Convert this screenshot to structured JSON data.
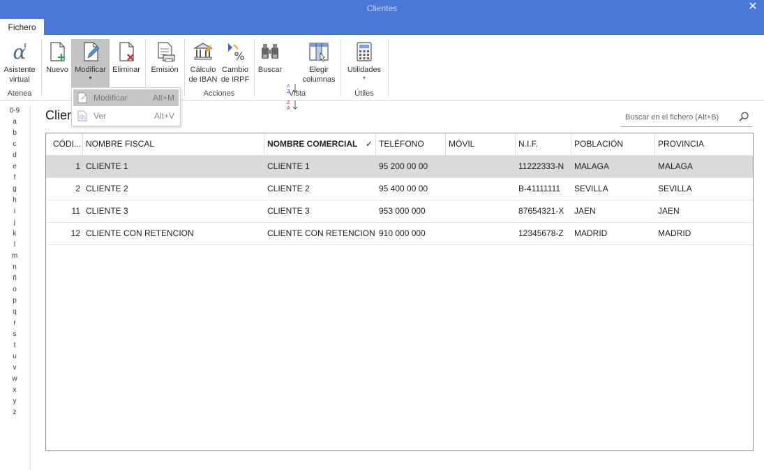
{
  "window": {
    "title": "Clientes",
    "close_glyph": "✕"
  },
  "menu": {
    "tab_fichero": "Fichero"
  },
  "ribbon": {
    "atenea": {
      "label1": "Asistente",
      "label2": "virtual",
      "group": "Atenea"
    },
    "nuevo": "Nuevo",
    "modificar": "Modificar",
    "eliminar": "Eliminar",
    "emision": "Emisión",
    "calculo_iban": {
      "label1": "Cálculo",
      "label2": "de IBAN"
    },
    "cambio_irpf": {
      "label1": "Cambio",
      "label2": "de IRPF"
    },
    "acciones_group": "Acciones",
    "buscar": "Buscar",
    "elegir_columnas": {
      "label1": "Elegir",
      "label2": "columnas"
    },
    "vista_group": "Vista",
    "utilidades": "Utilidades",
    "utiles_group": "Útiles",
    "dropdown_arrow": "▾"
  },
  "dropdown": {
    "items": [
      {
        "label": "Modificar",
        "shortcut": "Alt+M"
      },
      {
        "label": "Ver",
        "shortcut": "Alt+V"
      }
    ]
  },
  "alphabet": [
    "0-9",
    "a",
    "b",
    "c",
    "d",
    "e",
    "f",
    "g",
    "h",
    "i",
    "j",
    "k",
    "l",
    "m",
    "n",
    "ñ",
    "o",
    "p",
    "q",
    "r",
    "s",
    "t",
    "u",
    "v",
    "w",
    "x",
    "y",
    "z"
  ],
  "page": {
    "title": "Clientes"
  },
  "search": {
    "placeholder": "Buscar en el fichero (Alt+B)"
  },
  "table": {
    "columns": [
      "CÓDI...",
      "NOMBRE FISCAL",
      "NOMBRE COMERCIAL",
      "TELÉFONO",
      "MÓVIL",
      "N.I.F.",
      "POBLACIÓN",
      "PROVINCIA"
    ],
    "sort_mark": "✓",
    "rows": [
      {
        "codigo": "1",
        "nombre_fiscal": "CLIENTE 1",
        "nombre_comercial": "CLIENTE 1",
        "telefono": "95 200 00 00",
        "movil": "",
        "nif": "11222333-N",
        "poblacion": "MALAGA",
        "provincia": "MALAGA"
      },
      {
        "codigo": "2",
        "nombre_fiscal": "CLIENTE 2",
        "nombre_comercial": "CLIENTE 2",
        "telefono": "95 400 00 00",
        "movil": "",
        "nif": "B-41111111",
        "poblacion": "SEVILLA",
        "provincia": "SEVILLA"
      },
      {
        "codigo": "11",
        "nombre_fiscal": "CLIENTE 3",
        "nombre_comercial": "CLIENTE 3",
        "telefono": "953 000 000",
        "movil": "",
        "nif": "87654321-X",
        "poblacion": "JAEN",
        "provincia": "JAEN"
      },
      {
        "codigo": "12",
        "nombre_fiscal": "CLIENTE CON RETENCION",
        "nombre_comercial": "CLIENTE CON RETENCION",
        "telefono": "910 000 000",
        "movil": "",
        "nif": "12345678-Z",
        "poblacion": "MADRID",
        "provincia": "MADRID"
      }
    ]
  },
  "colors": {
    "titlebar": "#4a78d8",
    "selected_row": "#dadada",
    "active_button": "#c4c4c4"
  }
}
